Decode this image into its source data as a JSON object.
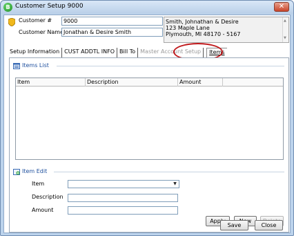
{
  "window": {
    "title": "Customer Setup 9000",
    "icon_letter": "B"
  },
  "customer": {
    "number_label": "Customer #",
    "number_value": "9000",
    "name_label": "Customer Name",
    "name_value": "Jonathan & Desire Smith",
    "address_lines": [
      "Smith, Johnathan & Desire",
      "123 Maple Lane",
      "Plymouth, MI  48170 - 5167"
    ]
  },
  "tabs": [
    {
      "label": "Setup Information",
      "state": "normal"
    },
    {
      "label": "CUST ADDTL INFO",
      "state": "normal"
    },
    {
      "label": "Bill To",
      "state": "normal"
    },
    {
      "label": "Master Account Setup",
      "state": "disabled"
    },
    {
      "label": "Items",
      "state": "active"
    }
  ],
  "items_list": {
    "heading": "Items List",
    "columns": [
      "Item",
      "Description",
      "Amount",
      ""
    ]
  },
  "item_edit": {
    "heading": "Item Edit",
    "item_label": "Item",
    "item_value": "",
    "description_label": "Description",
    "description_value": "",
    "amount_label": "Amount",
    "amount_value": ""
  },
  "buttons": {
    "apply": "Apply",
    "new": "New",
    "delete": "Delete",
    "save": "Save",
    "close": "Close"
  },
  "colors": {
    "highlight_ring": "#c0191c",
    "section_heading": "#1b4d9c"
  }
}
